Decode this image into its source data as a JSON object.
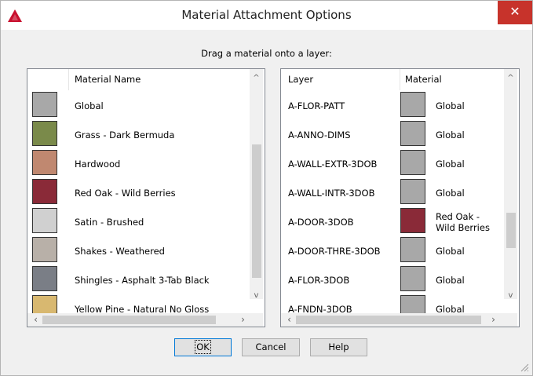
{
  "window": {
    "title": "Material Attachment Options",
    "close_glyph": "✕"
  },
  "instruction": "Drag a material onto a layer:",
  "materials": {
    "header": "Material Name",
    "items": [
      {
        "name": "Global",
        "color": "#a8a8a8"
      },
      {
        "name": "Grass - Dark Bermuda",
        "color": "#7a8a4a"
      },
      {
        "name": "Hardwood",
        "color": "#c08870"
      },
      {
        "name": "Red Oak - Wild Berries",
        "color": "#8a2a38"
      },
      {
        "name": "Satin - Brushed",
        "color": "#d0d0d0"
      },
      {
        "name": "Shakes - Weathered",
        "color": "#b8b0a8"
      },
      {
        "name": "Shingles - Asphalt 3-Tab Black",
        "color": "#7a7e86"
      },
      {
        "name": "Yellow Pine - Natural No Gloss",
        "color": "#d8b870"
      }
    ]
  },
  "layers": {
    "header_layer": "Layer",
    "header_material": "Material",
    "rows": [
      {
        "layer": "A-FLOR-PATT",
        "material": "Global",
        "color": "#a8a8a8"
      },
      {
        "layer": "A-ANNO-DIMS",
        "material": "Global",
        "color": "#a8a8a8"
      },
      {
        "layer": "A-WALL-EXTR-3DOB",
        "material": "Global",
        "color": "#a8a8a8"
      },
      {
        "layer": "A-WALL-INTR-3DOB",
        "material": "Global",
        "color": "#a8a8a8"
      },
      {
        "layer": "A-DOOR-3DOB",
        "material_line1": "Red Oak -",
        "material_line2": "Wild Berries",
        "color": "#8a2a38"
      },
      {
        "layer": "A-DOOR-THRE-3DOB",
        "material": "Global",
        "color": "#a8a8a8"
      },
      {
        "layer": "A-FLOR-3DOB",
        "material": "Global",
        "color": "#a8a8a8"
      },
      {
        "layer": "A-FNDN-3DOB",
        "material": "Global",
        "color": "#a8a8a8"
      }
    ]
  },
  "buttons": {
    "ok": "OK",
    "cancel": "Cancel",
    "help": "Help"
  },
  "colors": {
    "close_bg": "#c7332b",
    "app_icon": "#c8102e",
    "default_button_border": "#0078d7"
  }
}
